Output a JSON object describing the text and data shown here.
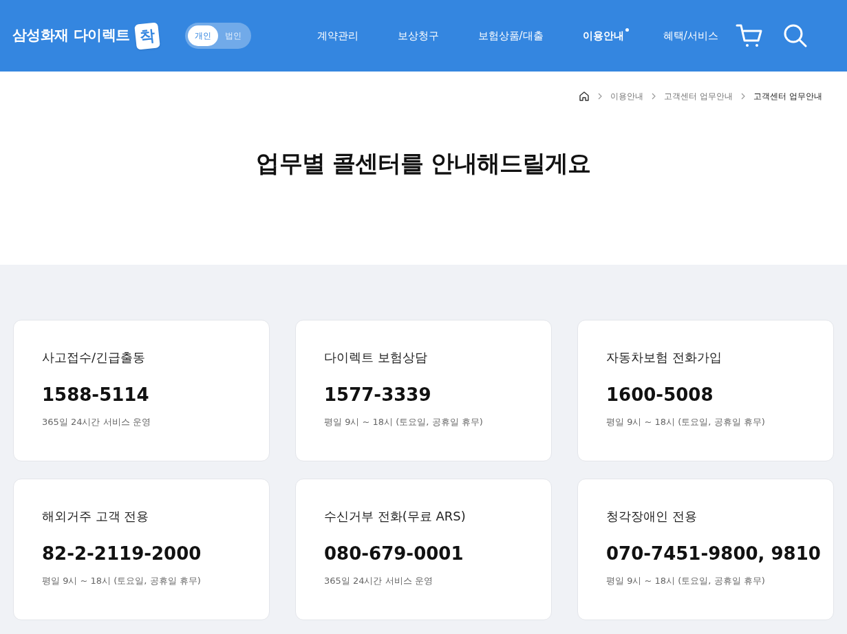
{
  "header": {
    "logo": {
      "text": "삼성화재 다이렉트",
      "badge": "착"
    },
    "segments": [
      {
        "label": "개인",
        "selected": true
      },
      {
        "label": "법인",
        "selected": false
      }
    ],
    "nav": [
      {
        "label": "계약관리",
        "selected": false
      },
      {
        "label": "보상청구",
        "selected": false
      },
      {
        "label": "보험상품/대출",
        "selected": false
      },
      {
        "label": "이용안내",
        "selected": true
      },
      {
        "label": "혜택/서비스",
        "selected": false
      }
    ]
  },
  "breadcrumb": [
    "이용안내",
    "고객센터 업무안내",
    "고객센터 업무안내"
  ],
  "title": "업무별 콜센터를 안내해드릴게요",
  "cards": [
    {
      "title": "사고접수/긴급출동",
      "phone": "1588-5114",
      "hours": "365일 24시간 서비스 운영"
    },
    {
      "title": "다이렉트 보험상담",
      "phone": "1577-3339",
      "hours": "평일 9시 ~ 18시 (토요일, 공휴일 휴무)"
    },
    {
      "title": "자동차보험 전화가입",
      "phone": "1600-5008",
      "hours": "평일 9시 ~ 18시 (토요일, 공휴일 휴무)"
    },
    {
      "title": "해외거주 고객 전용",
      "phone": "82-2-2119-2000",
      "hours": "평일 9시 ~ 18시 (토요일, 공휴일 휴무)"
    },
    {
      "title": "수신거부 전화(무료 ARS)",
      "phone": "080-679-0001",
      "hours": "365일 24시간 서비스 운영"
    },
    {
      "title": "청각장애인 전용",
      "phone": "070-7451-9800, 9810",
      "hours": "평일 9시 ~ 18시 (토요일, 공휴일 휴무)"
    }
  ]
}
